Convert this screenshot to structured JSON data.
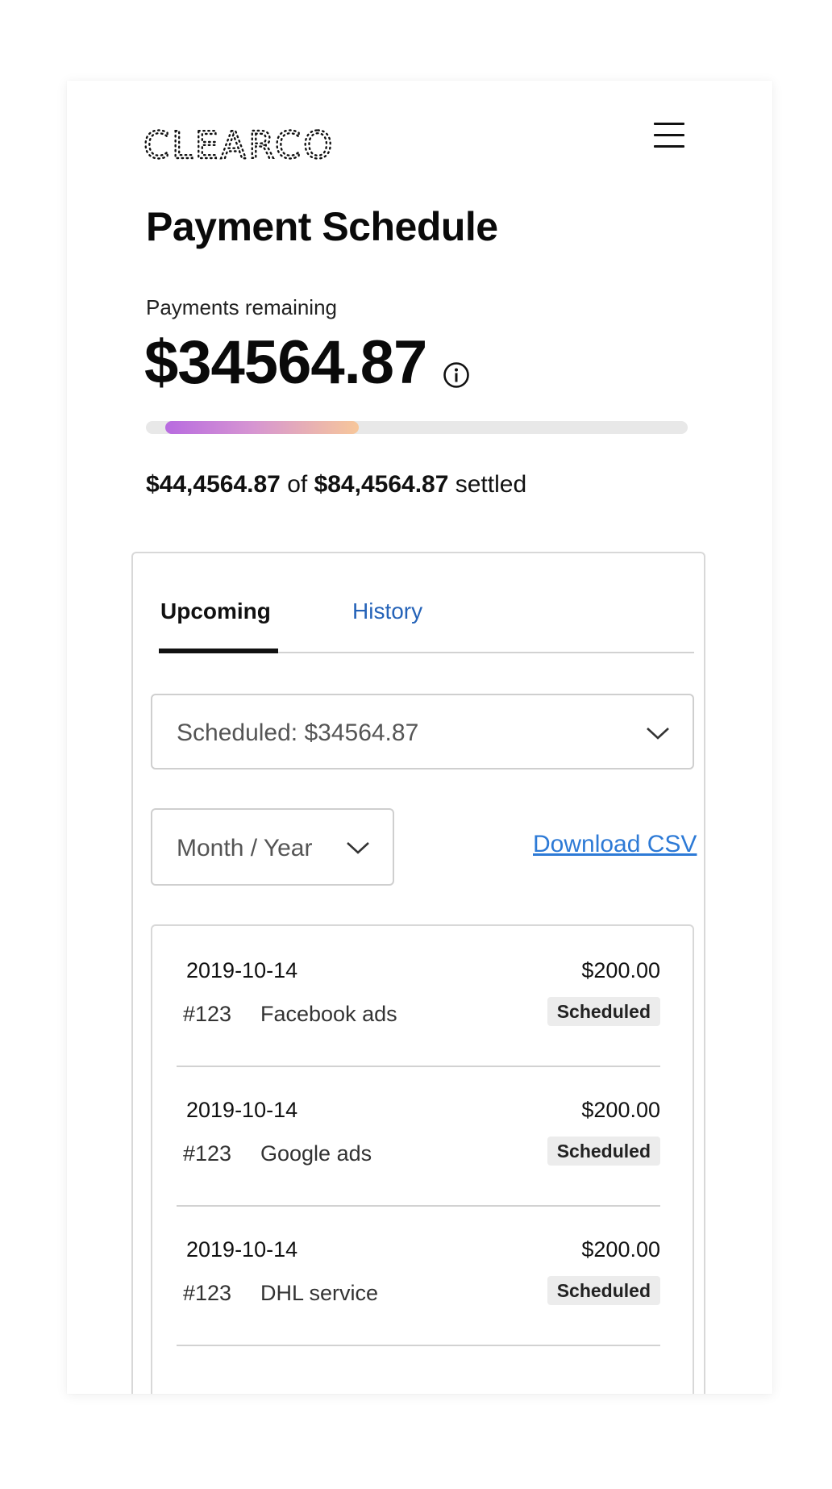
{
  "brand": {
    "logo_text": "CLEARCO"
  },
  "header": {
    "title": "Payment Schedule"
  },
  "summary": {
    "remaining_label": "Payments remaining",
    "remaining_amount": "$34564.87",
    "settled_amount": "$44,4564.87",
    "of_word": "of",
    "total_amount": "$84,4564.87",
    "settled_word": "settled",
    "progress_fraction": 0.37
  },
  "tabs": [
    {
      "label": "Upcoming",
      "active": true
    },
    {
      "label": "History",
      "active": false
    }
  ],
  "filters": {
    "scheduled_select": "Scheduled:  $34564.87",
    "month_select": "Month / Year",
    "download_label": "Download CSV"
  },
  "payments": [
    {
      "date": "2019-10-14",
      "amount": "$200.00",
      "id": "#123",
      "description": "Facebook ads",
      "status": "Scheduled"
    },
    {
      "date": "2019-10-14",
      "amount": "$200.00",
      "id": "#123",
      "description": "Google ads",
      "status": "Scheduled"
    },
    {
      "date": "2019-10-14",
      "amount": "$200.00",
      "id": "#123",
      "description": "DHL service",
      "status": "Scheduled"
    }
  ],
  "colors": {
    "link": "#2d7ad6",
    "tab_inactive": "#2563b8",
    "progress_start": "#b86be0",
    "progress_end": "#f7c79a"
  },
  "icons": [
    "menu-icon",
    "info-icon",
    "chevron-down-icon"
  ]
}
